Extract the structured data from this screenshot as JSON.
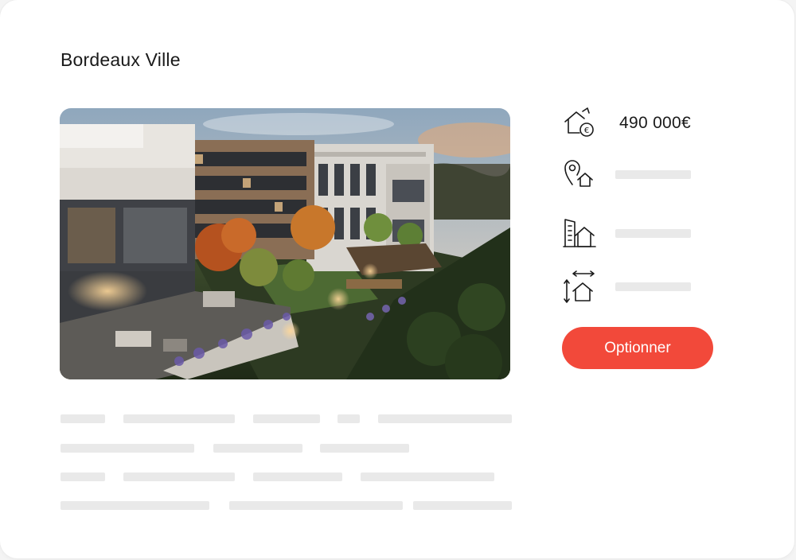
{
  "listing": {
    "title": "Bordeaux Ville",
    "image_description_icon": "apartment-building-photo"
  },
  "details": {
    "price": "490 000€",
    "price_icon": "house-euro-icon",
    "location_icon": "location-pin-house-icon",
    "floor_icon": "building-house-icon",
    "surface_icon": "house-dimensions-icon"
  },
  "actions": {
    "option_label": "Optionner"
  },
  "colors": {
    "accent": "#f2493a",
    "text": "#1a1a1a",
    "skeleton": "#e9e9e9"
  }
}
